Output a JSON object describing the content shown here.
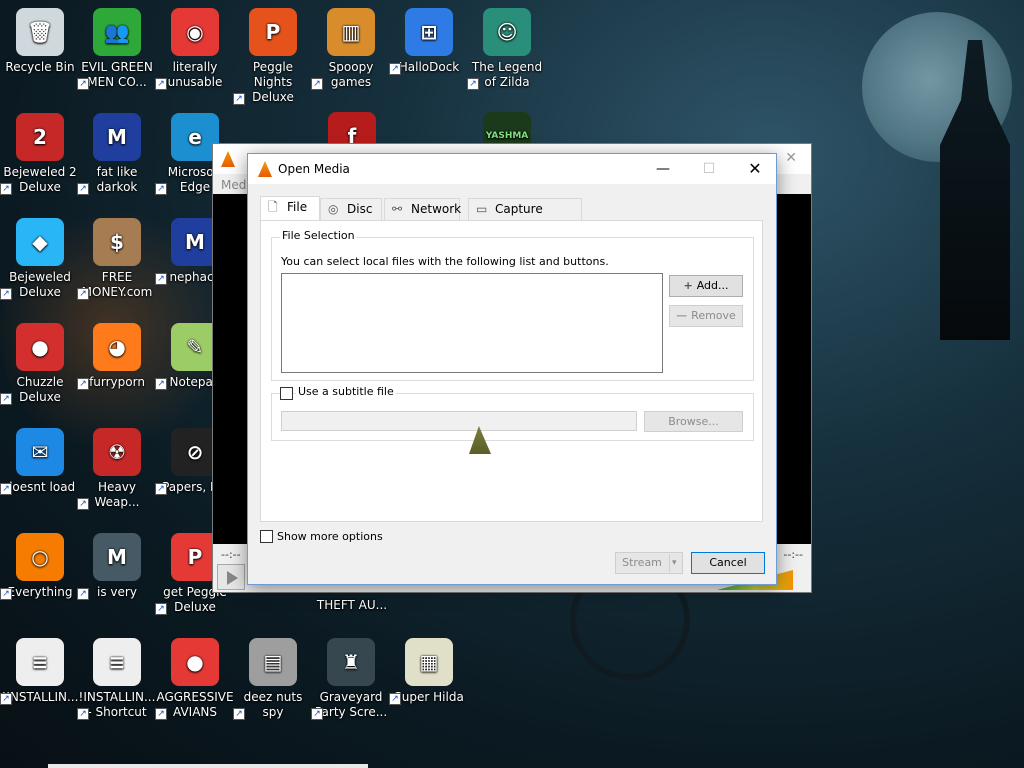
{
  "desktop": {
    "icons": [
      {
        "label": "Recycle Bin",
        "glyph": "🗑",
        "bg": "#cfd8dc"
      },
      {
        "label": "EVIL GREEN MEN CO...",
        "glyph": "👥",
        "bg": "#2fa83a"
      },
      {
        "label": "literally unusable",
        "glyph": "◉",
        "bg": "#e53935"
      },
      {
        "label": "Peggle Nights Deluxe",
        "glyph": "P",
        "bg": "#e5521b"
      },
      {
        "label": "Spoopy games",
        "glyph": "▥",
        "bg": "#d98c2b"
      },
      {
        "label": "HalloDock",
        "glyph": "⊞",
        "bg": "#2f7be5"
      },
      {
        "label": "The Legend of Zilda",
        "glyph": "☺",
        "bg": "#2a8f7a"
      },
      {
        "label": "Bejeweled 2 Deluxe",
        "glyph": "2",
        "bg": "#c62828"
      },
      {
        "label": "fat like darkok",
        "glyph": "M",
        "bg": "#1f3e9e"
      },
      {
        "label": "Microsoft Edge",
        "glyph": "e",
        "bg": "#1b8fd0"
      },
      {
        "label": "Bejeweled Deluxe",
        "glyph": "◆",
        "bg": "#29b6f6"
      },
      {
        "label": "FREE MONEY.com",
        "glyph": "$",
        "bg": "#a67c52"
      },
      {
        "label": "nephack",
        "glyph": "M",
        "bg": "#1f3e9e"
      },
      {
        "label": "Chuzzle Deluxe",
        "glyph": "●",
        "bg": "#d32f2f"
      },
      {
        "label": "furryporn",
        "glyph": "◕",
        "bg": "#ff7a1a"
      },
      {
        "label": "Notepad",
        "glyph": "✎",
        "bg": "#9ccc65"
      },
      {
        "label": "doesnt load",
        "glyph": "✉",
        "bg": "#1e88e5"
      },
      {
        "label": "Heavy Weap...",
        "glyph": "☢",
        "bg": "#c62828"
      },
      {
        "label": "Papers, Ple",
        "glyph": "⊘",
        "bg": "#222222"
      },
      {
        "label": "Everything",
        "glyph": "○",
        "bg": "#f57c00"
      },
      {
        "label": "is very",
        "glyph": "M",
        "bg": "#455a64"
      },
      {
        "label": "get Peggle Deluxe",
        "glyph": "P",
        "bg": "#e53935"
      },
      {
        "label": "!INSTALLIN...",
        "glyph": "≡",
        "bg": "#eeeeee"
      },
      {
        "label": "!INSTALLIN... - Shortcut",
        "glyph": "≡",
        "bg": "#eeeeee"
      },
      {
        "label": "AGGRESSIVE AVIANS",
        "glyph": "●",
        "bg": "#e53935"
      },
      {
        "label": "deez nuts spy",
        "glyph": "▤",
        "bg": "#9e9e9e"
      },
      {
        "label": "Graveyard Party Scre...",
        "glyph": "♜",
        "bg": "#37474f"
      },
      {
        "label": "Super Hilda",
        "glyph": "▦",
        "bg": "#e0e0c8"
      }
    ],
    "partial_icon_texts": {
      "flash_label": "f",
      "yashma": "YASHMA",
      "theft_auto": "THEFT AU..."
    }
  },
  "vlc": {
    "menu_text": "Medi",
    "time_left": "--:--",
    "time_right": "--:--",
    "close": "✕"
  },
  "dialog": {
    "title": "Open Media",
    "window_buttons": {
      "minimize": "—",
      "maximize": "☐",
      "close": "✕"
    },
    "tabs": [
      {
        "label": "File",
        "icon": "🗋"
      },
      {
        "label": "Disc",
        "icon": "◎"
      },
      {
        "label": "Network",
        "icon": "⚯"
      },
      {
        "label": "Capture Device",
        "icon": "▭"
      }
    ],
    "file_selection": {
      "legend": "File Selection",
      "help": "You can select local files with the following list and buttons.",
      "add_label": "Add...",
      "remove_label": "Remove",
      "add_icon": "+",
      "remove_icon": "—"
    },
    "subtitle": {
      "label": "Use a subtitle file",
      "browse_label": "Browse..."
    },
    "show_more_options": "Show more options",
    "stream_label": "Stream",
    "stream_arrow": "▾",
    "cancel_label": "Cancel"
  }
}
